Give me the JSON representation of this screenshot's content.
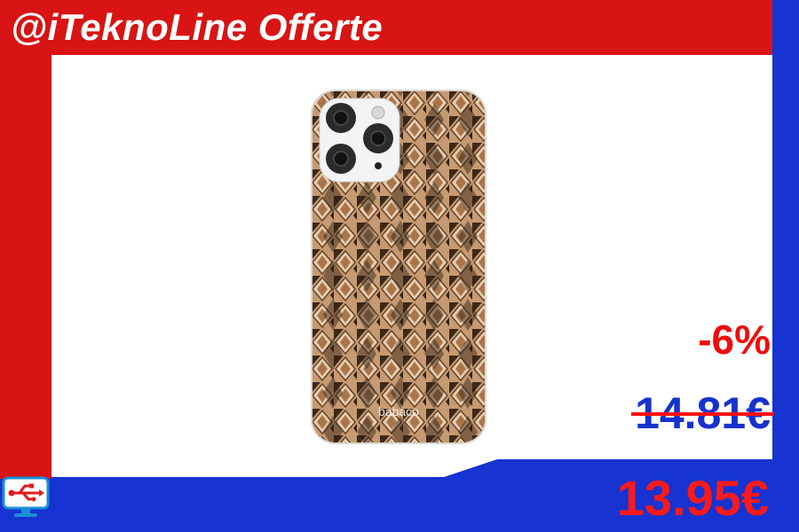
{
  "header": {
    "title": "@iTeknoLine Offerte"
  },
  "product": {
    "case_brand": "babaco"
  },
  "pricing": {
    "discount": "-6%",
    "old_price": "14.81€",
    "new_price": "13.95€"
  },
  "colors": {
    "brand_red": "#d81414",
    "brand_blue": "#1733d1",
    "price_red": "#ff1a1a"
  },
  "icons": [
    "usb-icon"
  ]
}
